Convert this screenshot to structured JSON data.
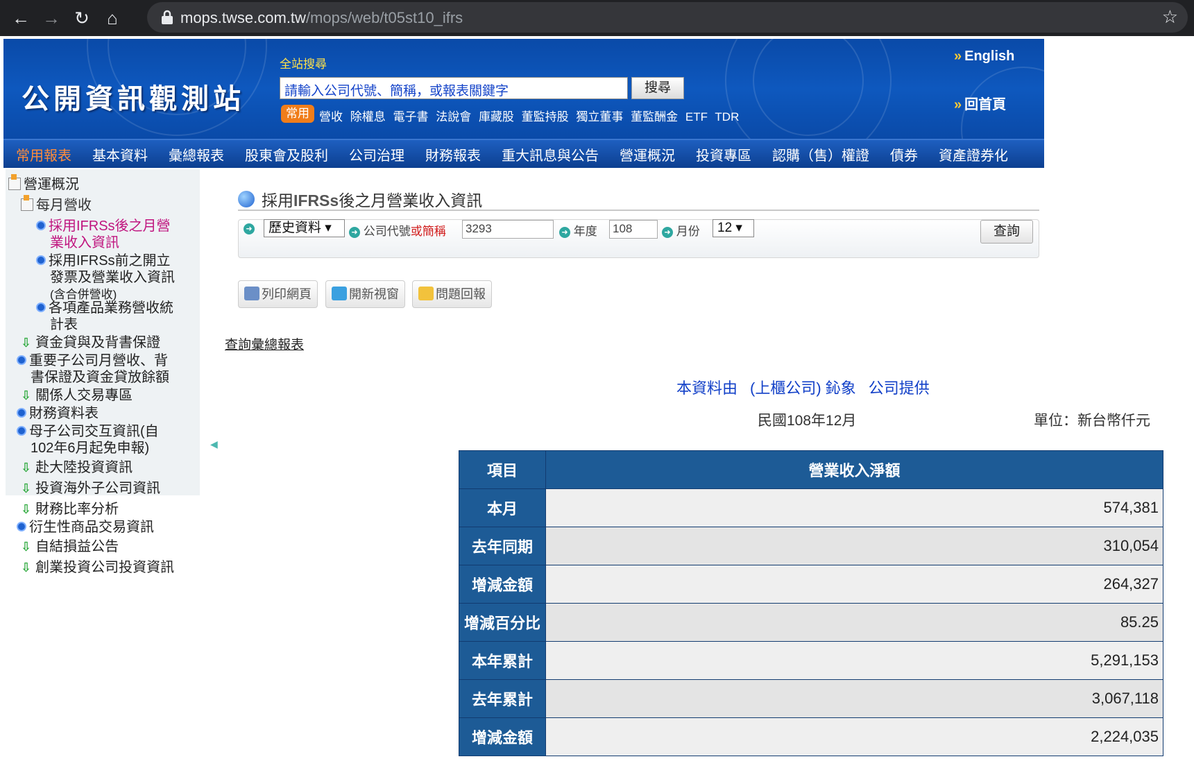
{
  "browser": {
    "url_host": "mops.twse.com.tw",
    "url_path": "/mops/web/t05st10_ifrs",
    "back_icon": "arrow-left-icon",
    "forward_icon": "arrow-right-icon",
    "reload_icon": "reload-icon",
    "home_icon": "home-icon"
  },
  "header": {
    "logo": "公開資訊觀測站",
    "search_title": "全站搜尋",
    "search_placeholder": "請輸入公司代號、簡稱，或報表關鍵字",
    "search_button": "搜尋",
    "common_tag": "常用",
    "quick_links": [
      "營收",
      "除權息",
      "電子書",
      "法說會",
      "庫藏股",
      "董監持股",
      "獨立董事",
      "董監酬金",
      "ETF",
      "TDR"
    ],
    "english": "English",
    "home": "回首頁"
  },
  "menu": [
    "常用報表",
    "基本資料",
    "彙總報表",
    "股東會及股利",
    "公司治理",
    "財務報表",
    "重大訊息與公告",
    "營運概況",
    "投資專區",
    "認購（售）權證",
    "債券",
    "資產證券化"
  ],
  "sidebar": {
    "root": "營運概況",
    "monthly": "每月營收",
    "current_line1": "採用IFRSs後之月營",
    "current_line2": "業收入資訊",
    "item2_line1": "採用IFRSs前之開立",
    "item2_line2": "發票及營業收入資訊",
    "item2_line3": "(含合併營收)",
    "item3_line1": "各項產品業務營收統",
    "item3_line2": "計表",
    "funds": "資金貸與及背書保證",
    "subsidiary_line1": "重要子公司月營收、背",
    "subsidiary_line2": "書保證及資金貸放餘額",
    "related": "關係人交易專區",
    "financial": "財務資料表",
    "parent_line1": "母子公司交互資訊(自",
    "parent_line2": "102年6月起免申報)",
    "china": "赴大陸投資資訊",
    "overseas": "投資海外子公司資訊",
    "ratio": "財務比率分析",
    "derivative": "衍生性商品交易資訊",
    "self": "自結損益公告",
    "venture": "創業投資公司投資資訊"
  },
  "main": {
    "heading_prefix": "採用",
    "heading_ifrs": "IFRSs",
    "heading_suffix": "後之月營業收入資訊",
    "history_select": "歷史資料",
    "company_label": "公司代號",
    "company_or": "或簡稱",
    "company_value": "3293",
    "year_label": "年度",
    "year_value": "108",
    "month_label": "月份",
    "month_value": "12",
    "query_button": "查詢",
    "print_button": "列印網頁",
    "new_window_button": "開新視窗",
    "report_button": "問題回報",
    "summary_link": "查詢彙總報表",
    "provider_prefix": "本資料由",
    "provider_market": "(上櫃公司) 鈊象",
    "provider_suffix": "公司提供",
    "period": "民國108年12月",
    "unit": "單位：新台幣仟元"
  },
  "table": {
    "header_item": "項目",
    "header_value": "營業收入淨額",
    "rows": [
      {
        "label": "本月",
        "value": "574,381"
      },
      {
        "label": "去年同期",
        "value": "310,054"
      },
      {
        "label": "增減金額",
        "value": "264,327"
      },
      {
        "label": "增減百分比",
        "value": "85.25"
      },
      {
        "label": "本年累計",
        "value": "5,291,153"
      },
      {
        "label": "去年累計",
        "value": "3,067,118"
      },
      {
        "label": "增減金額",
        "value": "2,224,035"
      }
    ]
  },
  "colors": {
    "header_blue": "#0a4aa8",
    "menu_active": "#ff8c3a",
    "table_header": "#1d5b96",
    "provider_text": "#1240c8",
    "sidebar_current": "#c0157f"
  }
}
